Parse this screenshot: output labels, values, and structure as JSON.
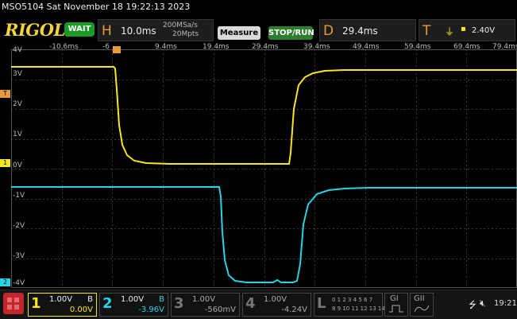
{
  "header": {
    "model_datetime": "MSO5104  Sat November 18 19:22:13 2023",
    "brand": "RIGOL",
    "run_state": "WAIT",
    "horizontal": {
      "letter": "H",
      "timebase": "10.0ms",
      "sample_rate": "200MSa/s",
      "mem_depth": "20Mpts"
    },
    "measure_label": "Measure",
    "stoprun_label": "STOP/RUN",
    "delay": {
      "letter": "D",
      "value": "29.4ms"
    },
    "trigger": {
      "letter": "T",
      "level": "2.40V"
    }
  },
  "time_labels": [
    "-10.6ms",
    "-6",
    "9.4ms",
    "19.4ms",
    "29.4ms",
    "39.4ms",
    "49.4ms",
    "59.4ms",
    "69.4ms",
    "79.4ms"
  ],
  "volt_labels": [
    "4V",
    "3V",
    "2V",
    "1V",
    "0V",
    "-1V",
    "-2V",
    "-3V",
    "-4V"
  ],
  "markers": {
    "ch1": "1",
    "trigger": "T",
    "ch2": "2"
  },
  "channels": [
    {
      "num": "1",
      "scale": "1.00V",
      "coupling": "B",
      "offset": "0.00V",
      "color": "#f5e71c",
      "active": true
    },
    {
      "num": "2",
      "scale": "1.00V",
      "coupling": "B",
      "offset": "-3.96V",
      "color": "#27d3e6",
      "active": true
    },
    {
      "num": "3",
      "scale": "1.00V",
      "coupling": "",
      "offset": "-560mV",
      "color": "#8a8a8a",
      "active": false
    },
    {
      "num": "4",
      "scale": "1.00V",
      "coupling": "",
      "offset": "-4.24V",
      "color": "#8a8a8a",
      "active": false
    }
  ],
  "logic": {
    "letter": "L",
    "row1": "0 1 2 3 4 5 6 7",
    "row2": "8 9 10 11 12 13 14 15"
  },
  "groups": [
    "GI",
    "GII"
  ],
  "status": {
    "time": "19:21"
  },
  "colors": {
    "ch1": "#f5e71c",
    "ch2": "#27d3e6",
    "accent": "#e89a36",
    "grid": "#3a3a3a"
  }
}
